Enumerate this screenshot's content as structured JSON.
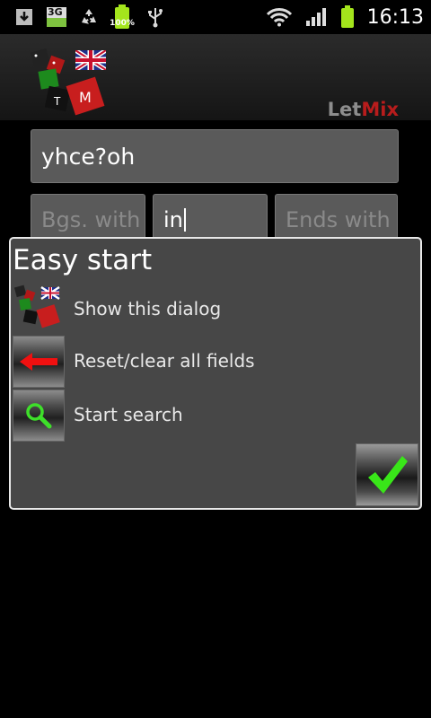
{
  "status_bar": {
    "network": "3G",
    "battery_small": "100%",
    "time": "16:13"
  },
  "header": {
    "brand_part1": "Let",
    "brand_part2": "Mix"
  },
  "form": {
    "pattern_value": "yhce?oh",
    "begins_placeholder": "Bgs. with",
    "contains_value": "in",
    "ends_placeholder": "Ends with"
  },
  "dialog": {
    "title": "Easy start",
    "items": [
      {
        "label": "Show this dialog",
        "icon": "dice-logo-icon"
      },
      {
        "label": "Reset/clear all fields",
        "icon": "red-arrow-left-icon"
      },
      {
        "label": "Start search",
        "icon": "search-icon"
      }
    ],
    "ok_icon": "check-icon"
  },
  "colors": {
    "brand_mix": "#b81c1c",
    "check_green": "#39e619",
    "battery_green": "#a4e51c"
  }
}
